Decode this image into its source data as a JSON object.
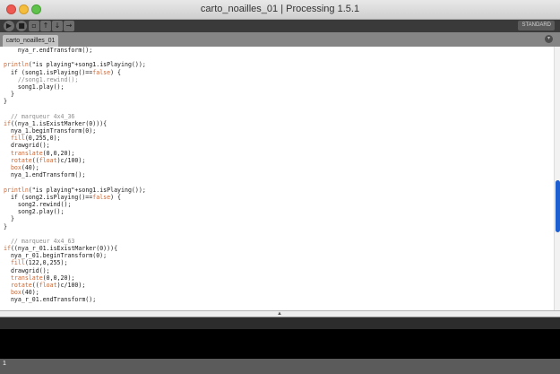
{
  "window": {
    "title": "carto_noailles_01 | Processing 1.5.1"
  },
  "toolbar": {
    "buttons": [
      {
        "name": "run-button",
        "glyph": "▶"
      },
      {
        "name": "stop-button",
        "glyph": "■"
      },
      {
        "name": "new-button",
        "glyph": "▫"
      },
      {
        "name": "open-button",
        "glyph": "↑"
      },
      {
        "name": "save-button",
        "glyph": "↓"
      },
      {
        "name": "export-button",
        "glyph": "→"
      }
    ],
    "mode_label": "STANDARD"
  },
  "tabs": [
    {
      "label": "carto_noailles_01"
    }
  ],
  "tab_menu_glyph": "▾",
  "code_lines": [
    [
      {
        "t": "    nya_r.endTransform();"
      }
    ],
    [],
    [
      {
        "t": "println",
        "c": "kw"
      },
      {
        "t": "(\"is playing\"+song1.isPlaying());"
      }
    ],
    [
      {
        "t": "  if (song1.isPlaying()=="
      },
      {
        "t": "false",
        "c": "kw"
      },
      {
        "t": ") {"
      }
    ],
    [
      {
        "t": "    //song1.rewind();",
        "c": "cm"
      }
    ],
    [
      {
        "t": "    song1.play();"
      }
    ],
    [
      {
        "t": "  }"
      }
    ],
    [
      {
        "t": "}"
      }
    ],
    [],
    [
      {
        "t": "  // marqueur 4x4_36",
        "c": "cm"
      }
    ],
    [
      {
        "t": "if",
        "c": "kw"
      },
      {
        "t": "((nya_1.isExistMarker(0))){"
      }
    ],
    [
      {
        "t": "  nya_1.beginTransform(0);"
      }
    ],
    [
      {
        "t": "  fill",
        "c": "kw"
      },
      {
        "t": "(0,255,0);"
      }
    ],
    [
      {
        "t": "  drawgrid();"
      }
    ],
    [
      {
        "t": "  translate",
        "c": "kw"
      },
      {
        "t": "(0,0,20);"
      }
    ],
    [
      {
        "t": "  rotate",
        "c": "kw"
      },
      {
        "t": "(("
      },
      {
        "t": "float",
        "c": "kw"
      },
      {
        "t": ")c/100);"
      }
    ],
    [
      {
        "t": "  box",
        "c": "kw"
      },
      {
        "t": "(40);"
      }
    ],
    [
      {
        "t": "  nya_1.endTransform();"
      }
    ],
    [],
    [
      {
        "t": "println",
        "c": "kw"
      },
      {
        "t": "(\"is playing\"+song1.isPlaying());"
      }
    ],
    [
      {
        "t": "  if (song2.isPlaying()=="
      },
      {
        "t": "false",
        "c": "kw"
      },
      {
        "t": ") {"
      }
    ],
    [
      {
        "t": "    song2.rewind();"
      }
    ],
    [
      {
        "t": "    song2.play();"
      }
    ],
    [
      {
        "t": "  }"
      }
    ],
    [
      {
        "t": "}"
      }
    ],
    [],
    [
      {
        "t": "  // marqueur 4x4_63",
        "c": "cm"
      }
    ],
    [
      {
        "t": "if",
        "c": "kw"
      },
      {
        "t": "((nya_r_01.isExistMarker(0))){"
      }
    ],
    [
      {
        "t": "  nya_r_01.beginTransform(0);"
      }
    ],
    [
      {
        "t": "  fill",
        "c": "kw"
      },
      {
        "t": "(122,0,255);"
      }
    ],
    [
      {
        "t": "  drawgrid();"
      }
    ],
    [
      {
        "t": "  translate",
        "c": "kw"
      },
      {
        "t": "(0,0,20);"
      }
    ],
    [
      {
        "t": "  rotate",
        "c": "kw"
      },
      {
        "t": "(("
      },
      {
        "t": "float",
        "c": "kw"
      },
      {
        "t": ")c/100);"
      }
    ],
    [
      {
        "t": "  box",
        "c": "kw"
      },
      {
        "t": "(40);"
      }
    ],
    [
      {
        "t": "  nya_r_01.endTransform();"
      }
    ],
    [],
    [
      {
        "t": "println",
        "c": "kw"
      },
      {
        "t": "(\"is playing\"+song1.isPlaying());"
      }
    ]
  ],
  "editor": {
    "scroll_position": 0.63
  },
  "status": {
    "line_number": "1"
  },
  "colors": {
    "keyword": "#cc6633",
    "comment": "#8e8e8e",
    "scroll_thumb": "#1d5fd1"
  }
}
